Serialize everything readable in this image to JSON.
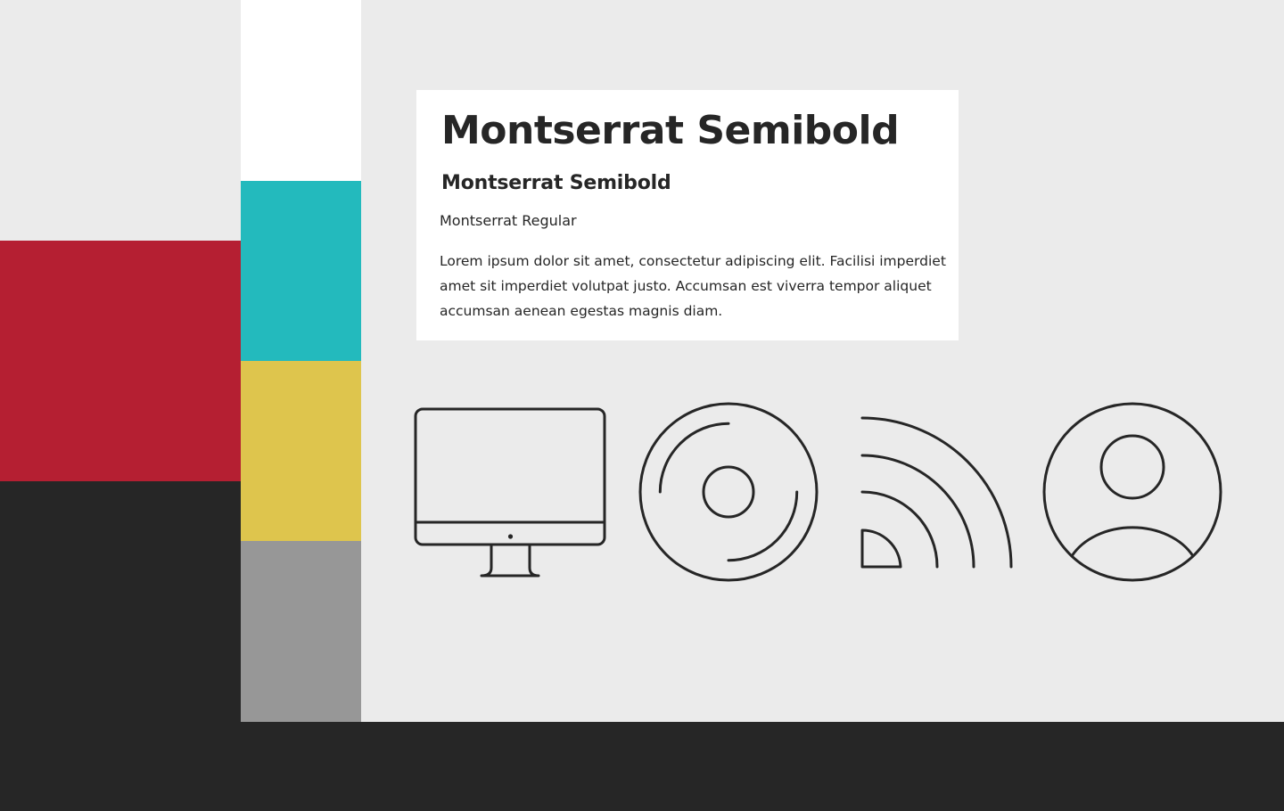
{
  "palette": {
    "background": "#ebebeb",
    "white": "#ffffff",
    "red": "#b51f32",
    "teal": "#23babd",
    "yellow": "#dec54d",
    "gray": "#979797",
    "dark": "#262626"
  },
  "typography": {
    "heading_large": "Montserrat Semibold",
    "heading_medium": "Montserrat Semibold",
    "label_regular": "Montserrat Regular",
    "body_text": "Lorem ipsum dolor sit amet, consectetur adipiscing elit. Facilisi imperdiet amet sit imperdiet volutpat justo. Accumsan est viverra tempor aliquet accumsan aenean egestas magnis diam."
  },
  "icons": [
    "monitor-icon",
    "disc-icon",
    "rss-icon",
    "user-icon"
  ]
}
